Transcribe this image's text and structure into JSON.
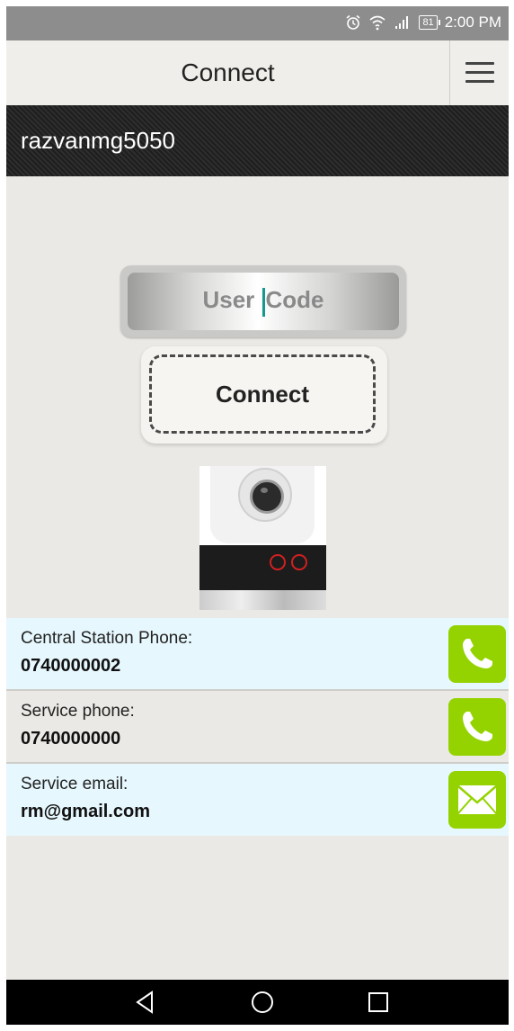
{
  "status_bar": {
    "time": "2:00 PM",
    "battery": "81",
    "icons": [
      "alarm-icon",
      "wifi-icon",
      "signal-icon",
      "battery-icon"
    ]
  },
  "header": {
    "title": "Connect",
    "menu_icon": "hamburger-menu-icon"
  },
  "user_bar": {
    "username": "razvanmg5050"
  },
  "form": {
    "code_placeholder": "User Code",
    "connect_label": "Connect"
  },
  "device_image": {
    "icon": "camera-device-image"
  },
  "contacts": [
    {
      "label": "Central Station Phone:",
      "value": "0740000002",
      "action_icon": "phone-icon"
    },
    {
      "label": "Service phone:",
      "value": "0740000000",
      "action_icon": "phone-icon"
    },
    {
      "label": "Service email:",
      "value": "rm@gmail.com",
      "action_icon": "email-icon"
    }
  ],
  "nav_bar": {
    "buttons": [
      "back-icon",
      "home-icon",
      "recents-icon"
    ]
  },
  "colors": {
    "accent_green": "#94d300",
    "user_bar": "#1e1e1e",
    "background": "#ebe9e5",
    "row_highlight": "#e6f7fd",
    "caret": "#14998c"
  }
}
